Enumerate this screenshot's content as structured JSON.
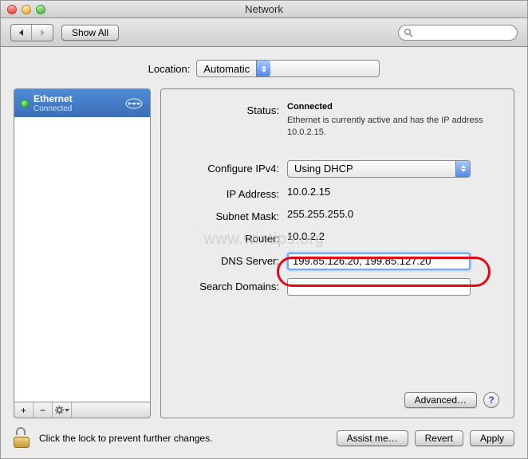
{
  "window": {
    "title": "Network"
  },
  "toolbar": {
    "show_all": "Show All",
    "search_placeholder": ""
  },
  "location": {
    "label": "Location:",
    "value": "Automatic"
  },
  "sidebar": {
    "items": [
      {
        "name": "Ethernet",
        "status": "Connected"
      }
    ],
    "add": "+",
    "remove": "−",
    "gear": "✻"
  },
  "details": {
    "status_label": "Status:",
    "status_value": "Connected",
    "status_sub": "Ethernet is currently active and has the IP address 10.0.2.15.",
    "configure_label": "Configure IPv4:",
    "configure_value": "Using DHCP",
    "ip_label": "IP Address:",
    "ip_value": "10.0.2.15",
    "subnet_label": "Subnet Mask:",
    "subnet_value": "255.255.255.0",
    "router_label": "Router:",
    "router_value": "10.0.2.2",
    "dns_label": "DNS Server:",
    "dns_value": "199.85.126.20, 199.85.127.20",
    "search_label": "Search Domains:",
    "search_value": "",
    "advanced": "Advanced…"
  },
  "footer": {
    "lock_hint": "Click the lock to prevent further changes.",
    "assist": "Assist me…",
    "revert": "Revert",
    "apply": "Apply"
  },
  "watermark": "www.wintips.org"
}
